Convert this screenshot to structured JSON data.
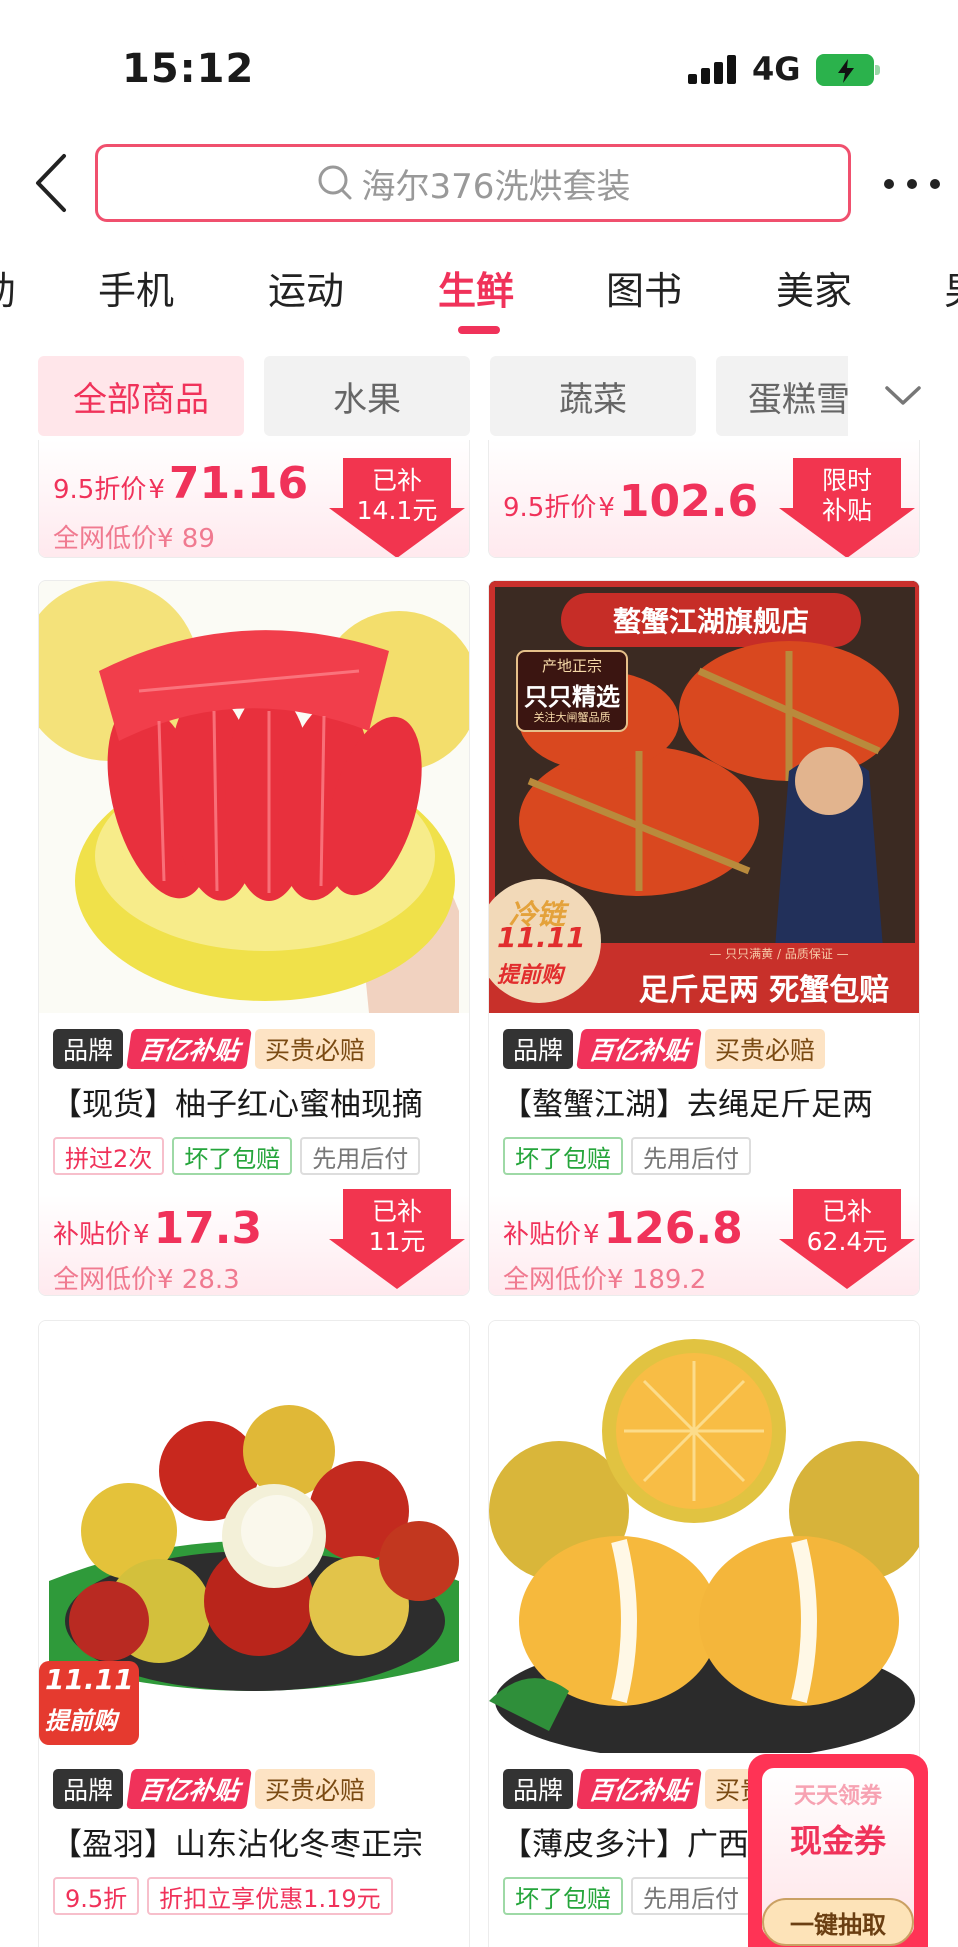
{
  "status_bar": {
    "time": "15:12",
    "network": "4G"
  },
  "search": {
    "placeholder": "海尔376洗烘套装"
  },
  "category_tabs": [
    {
      "label": "助",
      "active": false
    },
    {
      "label": "手机",
      "active": false
    },
    {
      "label": "运动",
      "active": false
    },
    {
      "label": "生鲜",
      "active": true
    },
    {
      "label": "图书",
      "active": false
    },
    {
      "label": "美家",
      "active": false
    },
    {
      "label": "男",
      "active": false
    }
  ],
  "filters": [
    {
      "label": "全部商品",
      "active": true
    },
    {
      "label": "水果",
      "active": false
    },
    {
      "label": "蔬菜",
      "active": false
    },
    {
      "label": "蛋糕雪糕",
      "active": false
    }
  ],
  "products": [
    {
      "price_label": "9.5折价",
      "yen": "¥",
      "price": "71.16",
      "orig_label": "全网低价¥ 89",
      "badge_line1": "已补",
      "badge_line2": "14.1元"
    },
    {
      "price_label": "9.5折价",
      "yen": "¥",
      "price": "102.6",
      "orig_label": "",
      "badge_line1": "限时",
      "badge_line2": "补贴"
    },
    {
      "tags": [
        "品牌",
        "百亿补贴",
        "买贵必赔"
      ],
      "title": "【现货】柚子红心蜜柚现摘",
      "services": [
        "拼过2次",
        "坏了包赔",
        "先用后付"
      ],
      "price_label": "补贴价",
      "yen": "¥",
      "price": "17.3",
      "orig_label": "全网低价¥ 28.3",
      "badge_line1": "已补",
      "badge_line2": "11元"
    },
    {
      "image_texts": {
        "store": "螯蟹江湖旗舰店",
        "origin": "产地正宗",
        "selected": "只只精选",
        "note": "关注大闸蟹品质",
        "promo1": "冷链",
        "promo_n": "11.11",
        "promo_t": "提前购",
        "tagline": "— 只只满黄 / 品质保证 —",
        "banner": "足斤足两 死蟹包赔"
      },
      "tags": [
        "品牌",
        "百亿补贴",
        "买贵必赔"
      ],
      "title": "【螯蟹江湖】去绳足斤足两",
      "services": [
        "坏了包赔",
        "先用后付"
      ],
      "price_label": "补贴价",
      "yen": "¥",
      "price": "126.8",
      "orig_label": "全网低价¥ 189.2",
      "badge_line1": "已补",
      "badge_line2": "62.4元"
    },
    {
      "image_texts": {
        "promo_n": "11.11",
        "promo_t": "提前购"
      },
      "tags": [
        "品牌",
        "百亿补贴",
        "买贵必赔"
      ],
      "title": "【盈羽】山东沾化冬枣正宗",
      "services": [
        "9.5折",
        "折扣立享优惠1.19元"
      ]
    },
    {
      "tags": [
        "品牌",
        "百亿补贴",
        "买贵必赔"
      ],
      "title": "【薄皮多汁】广西",
      "services": [
        "坏了包赔",
        "先用后付"
      ]
    }
  ],
  "coupon": {
    "line1": "天天领券",
    "line2": "现金券",
    "button": "一键抽取"
  },
  "colors": {
    "accent": "#f0325a",
    "brand_dark": "#333333",
    "green": "#25a53b"
  },
  "icons": [
    "back-arrow-icon",
    "search-icon",
    "more-dots-icon",
    "chevron-down-icon",
    "signal-icon",
    "battery-charging-icon"
  ]
}
